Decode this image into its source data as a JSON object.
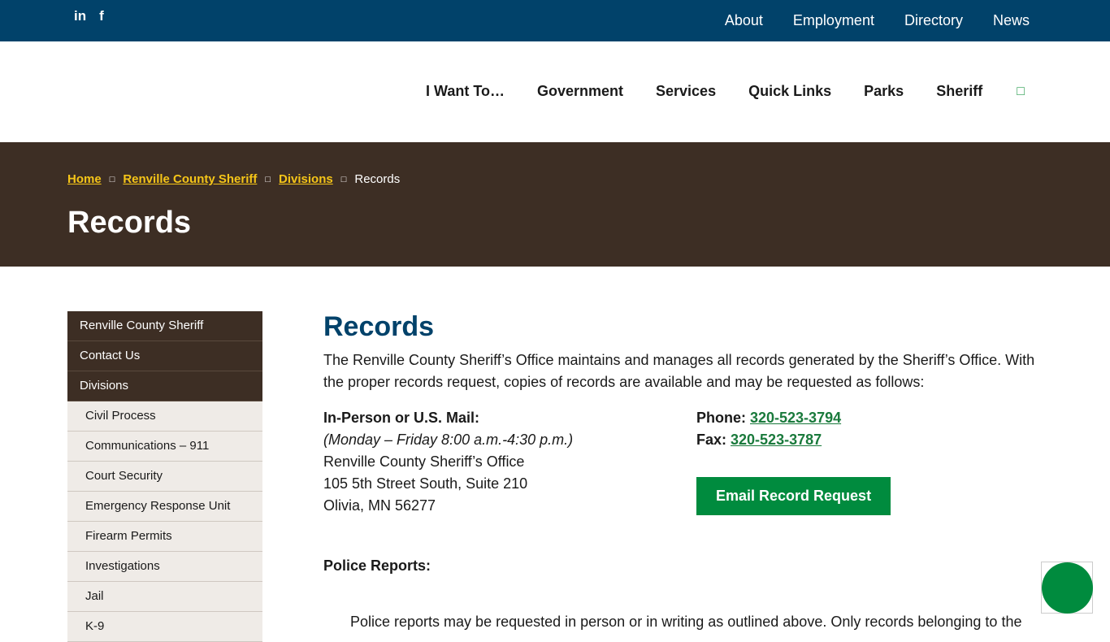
{
  "social": {
    "linkedin": "in",
    "facebook": "f"
  },
  "utility_nav": [
    "About",
    "Employment",
    "Directory",
    "News"
  ],
  "main_nav": [
    "I Want To…",
    "Government",
    "Services",
    "Quick Links",
    "Parks",
    "Sheriff"
  ],
  "breadcrumb": {
    "home": "Home",
    "sheriff": "Renville County Sheriff",
    "divisions": "Divisions",
    "current": "Records"
  },
  "hero_title": "Records",
  "sidebar": {
    "top": [
      "Renville County Sheriff",
      "Contact Us",
      "Divisions"
    ],
    "sub": [
      "Civil Process",
      "Communications – 911",
      "Court Security",
      "Emergency Response Unit",
      "Firearm Permits",
      "Investigations",
      "Jail",
      "K-9"
    ]
  },
  "content": {
    "title": "Records",
    "intro": "The Renville County Sheriff’s Office maintains and manages all records generated by the Sheriff’s Office.  With the proper records request, copies of records are available and may be requested as follows:",
    "mail_heading": "In-Person or U.S. Mail:",
    "hours": "(Monday – Friday 8:00 a.m.-4:30 p.m.)",
    "office": "Renville County Sheriff’s Office",
    "street": "105 5th Street South, Suite 210",
    "city": "Olivia, MN 56277",
    "phone_label": "Phone: ",
    "phone": "320-523-3794",
    "fax_label": "Fax: ",
    "fax": "320-523-3787",
    "email_button": "Email Record Request",
    "police_heading": "Police Reports:",
    "police_text": "Police reports may be requested in person or in writing as outlined above. Only records belonging to the"
  },
  "colors": {
    "topbar": "#01426a",
    "hero": "#3d2e24",
    "accent_green": "#008b3e",
    "breadcrumb_link": "#f5c518"
  }
}
